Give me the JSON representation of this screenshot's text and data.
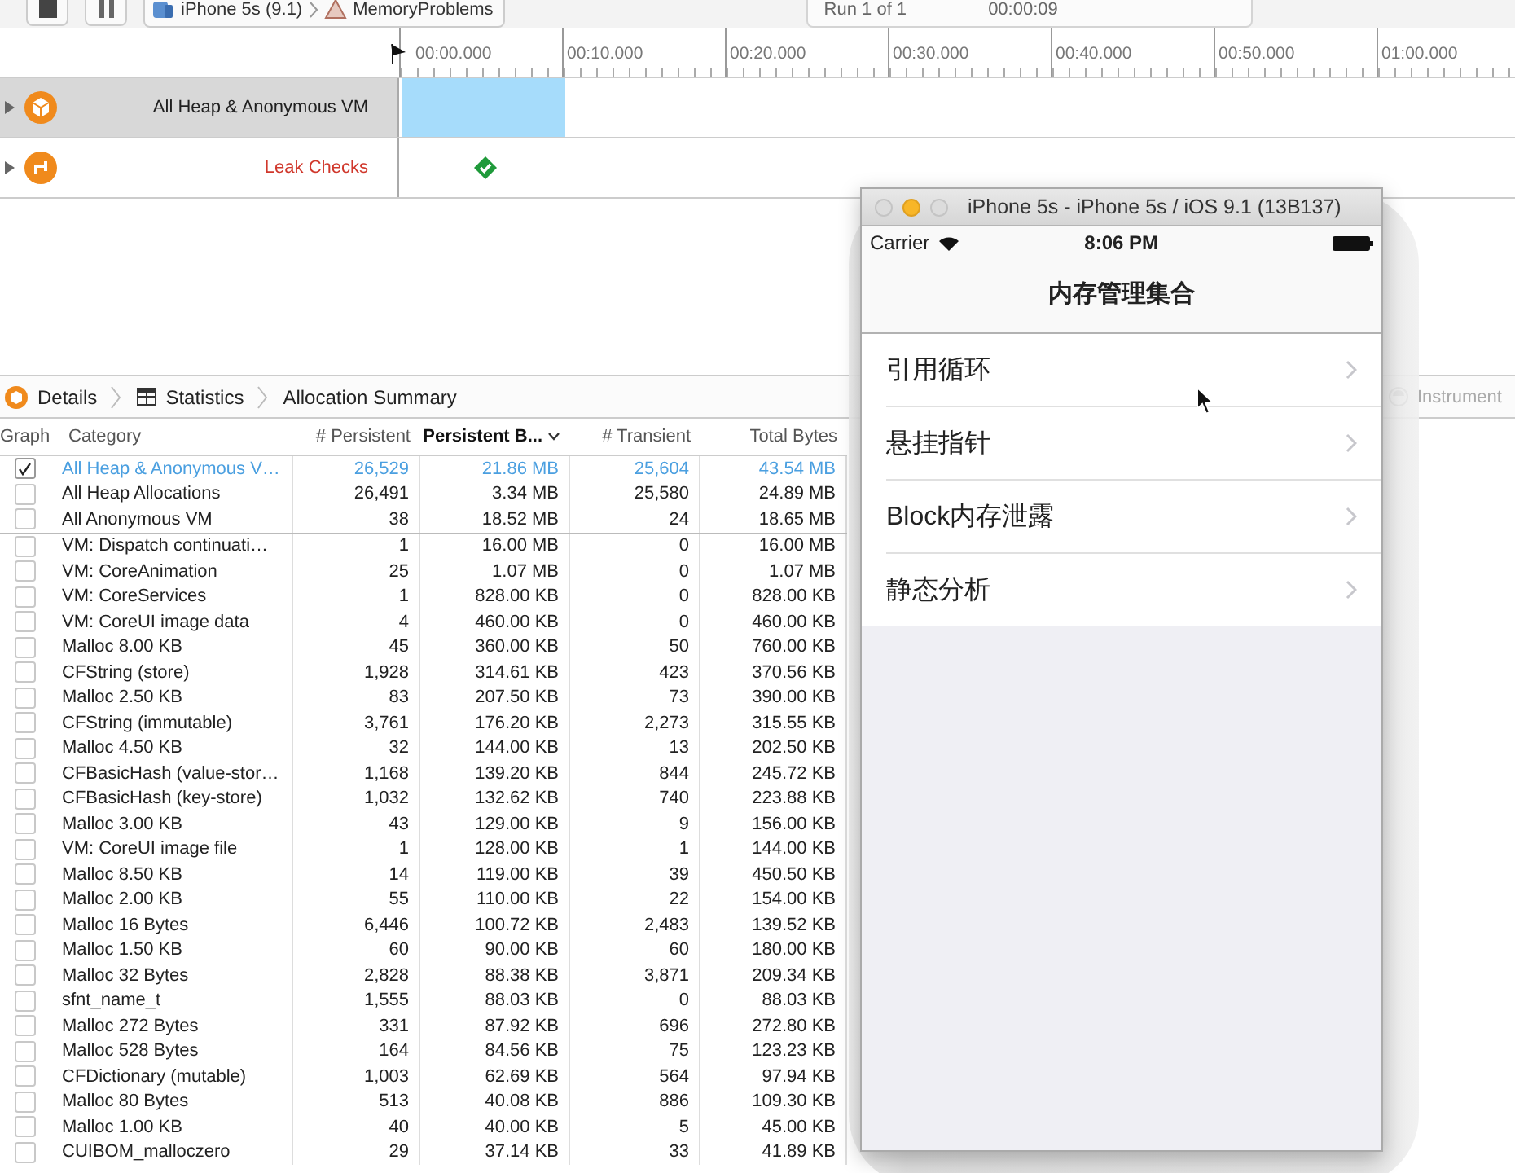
{
  "toolbar": {
    "device": "iPhone 5s (9.1)",
    "target": "MemoryProblems",
    "run": "Run 1 of 1",
    "elapsed": "00:00:09"
  },
  "timeline": {
    "ticks": [
      "00:00.000",
      "00:10.000",
      "00:20.000",
      "00:30.000",
      "00:40.000",
      "00:50.000",
      "01:00.000"
    ],
    "tracks": [
      {
        "name": "All Heap & Anonymous VM",
        "kind": "allocations",
        "selected": true,
        "color": "#1f1f1f"
      },
      {
        "name": "Leak Checks",
        "kind": "leaks",
        "selected": false,
        "color": "#d0382c"
      }
    ]
  },
  "details": {
    "breadcrumbs": [
      "Details",
      "Statistics",
      "Allocation Summary"
    ],
    "filter_placeholder": "Instrument"
  },
  "table": {
    "columns": [
      {
        "label": "Graph",
        "sorted": false
      },
      {
        "label": "Category",
        "sorted": false
      },
      {
        "label": "# Persistent",
        "sorted": false
      },
      {
        "label": "Persistent B...",
        "sorted": true
      },
      {
        "label": "# Transient",
        "sorted": false
      },
      {
        "label": "Total Bytes",
        "sorted": false
      }
    ],
    "rows": [
      {
        "kind": "summary",
        "checked": true,
        "selected": true,
        "cells": [
          "",
          "All Heap & Anonymous V…",
          "26,529",
          "21.86 MB",
          "25,604",
          "43.54 MB"
        ]
      },
      {
        "kind": "summary",
        "checked": false,
        "selected": false,
        "cells": [
          "",
          "All Heap Allocations",
          "26,491",
          "3.34 MB",
          "25,580",
          "24.89 MB"
        ]
      },
      {
        "kind": "summary",
        "checked": false,
        "selected": false,
        "cells": [
          "",
          "All Anonymous VM",
          "38",
          "18.52 MB",
          "24",
          "18.65 MB"
        ]
      },
      {
        "kind": "category",
        "checked": false,
        "selected": false,
        "cells": [
          "",
          "VM: Dispatch continuati…",
          "1",
          "16.00 MB",
          "0",
          "16.00 MB"
        ]
      },
      {
        "kind": "category",
        "checked": false,
        "selected": false,
        "cells": [
          "",
          "VM: CoreAnimation",
          "25",
          "1.07 MB",
          "0",
          "1.07 MB"
        ]
      },
      {
        "kind": "category",
        "checked": false,
        "selected": false,
        "cells": [
          "",
          "VM: CoreServices",
          "1",
          "828.00 KB",
          "0",
          "828.00 KB"
        ]
      },
      {
        "kind": "category",
        "checked": false,
        "selected": false,
        "cells": [
          "",
          "VM: CoreUI image data",
          "4",
          "460.00 KB",
          "0",
          "460.00 KB"
        ]
      },
      {
        "kind": "category",
        "checked": false,
        "selected": false,
        "cells": [
          "",
          "Malloc 8.00 KB",
          "45",
          "360.00 KB",
          "50",
          "760.00 KB"
        ]
      },
      {
        "kind": "category",
        "checked": false,
        "selected": false,
        "cells": [
          "",
          "CFString (store)",
          "1,928",
          "314.61 KB",
          "423",
          "370.56 KB"
        ]
      },
      {
        "kind": "category",
        "checked": false,
        "selected": false,
        "cells": [
          "",
          "Malloc 2.50 KB",
          "83",
          "207.50 KB",
          "73",
          "390.00 KB"
        ]
      },
      {
        "kind": "category",
        "checked": false,
        "selected": false,
        "cells": [
          "",
          "CFString (immutable)",
          "3,761",
          "176.20 KB",
          "2,273",
          "315.55 KB"
        ]
      },
      {
        "kind": "category",
        "checked": false,
        "selected": false,
        "cells": [
          "",
          "Malloc 4.50 KB",
          "32",
          "144.00 KB",
          "13",
          "202.50 KB"
        ]
      },
      {
        "kind": "category",
        "checked": false,
        "selected": false,
        "cells": [
          "",
          "CFBasicHash (value-stor…",
          "1,168",
          "139.20 KB",
          "844",
          "245.72 KB"
        ]
      },
      {
        "kind": "category",
        "checked": false,
        "selected": false,
        "cells": [
          "",
          "CFBasicHash (key-store)",
          "1,032",
          "132.62 KB",
          "740",
          "223.88 KB"
        ]
      },
      {
        "kind": "category",
        "checked": false,
        "selected": false,
        "cells": [
          "",
          "Malloc 3.00 KB",
          "43",
          "129.00 KB",
          "9",
          "156.00 KB"
        ]
      },
      {
        "kind": "category",
        "checked": false,
        "selected": false,
        "cells": [
          "",
          "VM: CoreUI image file",
          "1",
          "128.00 KB",
          "1",
          "144.00 KB"
        ]
      },
      {
        "kind": "category",
        "checked": false,
        "selected": false,
        "cells": [
          "",
          "Malloc 8.50 KB",
          "14",
          "119.00 KB",
          "39",
          "450.50 KB"
        ]
      },
      {
        "kind": "category",
        "checked": false,
        "selected": false,
        "cells": [
          "",
          "Malloc 2.00 KB",
          "55",
          "110.00 KB",
          "22",
          "154.00 KB"
        ]
      },
      {
        "kind": "category",
        "checked": false,
        "selected": false,
        "cells": [
          "",
          "Malloc 16 Bytes",
          "6,446",
          "100.72 KB",
          "2,483",
          "139.52 KB"
        ]
      },
      {
        "kind": "category",
        "checked": false,
        "selected": false,
        "cells": [
          "",
          "Malloc 1.50 KB",
          "60",
          "90.00 KB",
          "60",
          "180.00 KB"
        ]
      },
      {
        "kind": "category",
        "checked": false,
        "selected": false,
        "cells": [
          "",
          "Malloc 32 Bytes",
          "2,828",
          "88.38 KB",
          "3,871",
          "209.34 KB"
        ]
      },
      {
        "kind": "category",
        "checked": false,
        "selected": false,
        "cells": [
          "",
          "sfnt_name_t",
          "1,555",
          "88.03 KB",
          "0",
          "88.03 KB"
        ]
      },
      {
        "kind": "category",
        "checked": false,
        "selected": false,
        "cells": [
          "",
          "Malloc 272 Bytes",
          "331",
          "87.92 KB",
          "696",
          "272.80 KB"
        ]
      },
      {
        "kind": "category",
        "checked": false,
        "selected": false,
        "cells": [
          "",
          "Malloc 528 Bytes",
          "164",
          "84.56 KB",
          "75",
          "123.23 KB"
        ]
      },
      {
        "kind": "category",
        "checked": false,
        "selected": false,
        "cells": [
          "",
          "CFDictionary (mutable)",
          "1,003",
          "62.69 KB",
          "564",
          "97.94 KB"
        ]
      },
      {
        "kind": "category",
        "checked": false,
        "selected": false,
        "cells": [
          "",
          "Malloc 80 Bytes",
          "513",
          "40.08 KB",
          "886",
          "109.30 KB"
        ]
      },
      {
        "kind": "category",
        "checked": false,
        "selected": false,
        "cells": [
          "",
          "Malloc 1.00 KB",
          "40",
          "40.00 KB",
          "5",
          "45.00 KB"
        ]
      },
      {
        "kind": "category",
        "checked": false,
        "selected": false,
        "cells": [
          "",
          "CUIBOM_malloczero",
          "29",
          "37.14 KB",
          "33",
          "41.89 KB"
        ]
      }
    ]
  },
  "simulator": {
    "title": "iPhone 5s - iPhone 5s / iOS 9.1 (13B137)",
    "carrier": "Carrier",
    "time": "8:06 PM",
    "nav_title": "内存管理集合",
    "items": [
      "引用循环",
      "悬挂指针",
      "Block内存泄露",
      "静态分析"
    ]
  }
}
